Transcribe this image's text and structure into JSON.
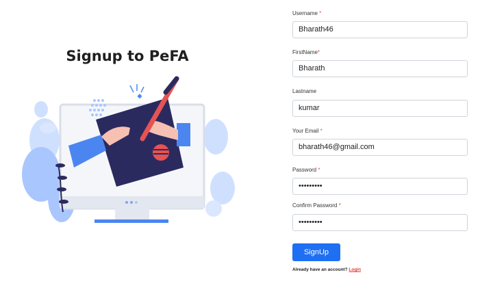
{
  "page": {
    "title": "Signup to PeFA"
  },
  "form": {
    "username": {
      "label": "Username",
      "required": "*",
      "value": "Bharath46"
    },
    "firstname": {
      "label": "FirstName",
      "required": "*",
      "value": "Bharath"
    },
    "lastname": {
      "label": "Lastname",
      "value": "kumar"
    },
    "email": {
      "label": "Your Email",
      "required": "*",
      "value": "bharath46@gmail.com"
    },
    "password": {
      "label": "Password",
      "required": "*",
      "value": "•••••••••"
    },
    "confirm": {
      "label": "Confirm Password",
      "required": "*",
      "value": "•••••••••"
    },
    "submit_label": "SignUp",
    "footer_text": "Already have an account?",
    "login_link": "Login"
  },
  "colors": {
    "primary": "#1f6ff2",
    "link": "#e53935",
    "navy": "#2b2a5f",
    "illustration_blue": "#6ea8ff"
  }
}
